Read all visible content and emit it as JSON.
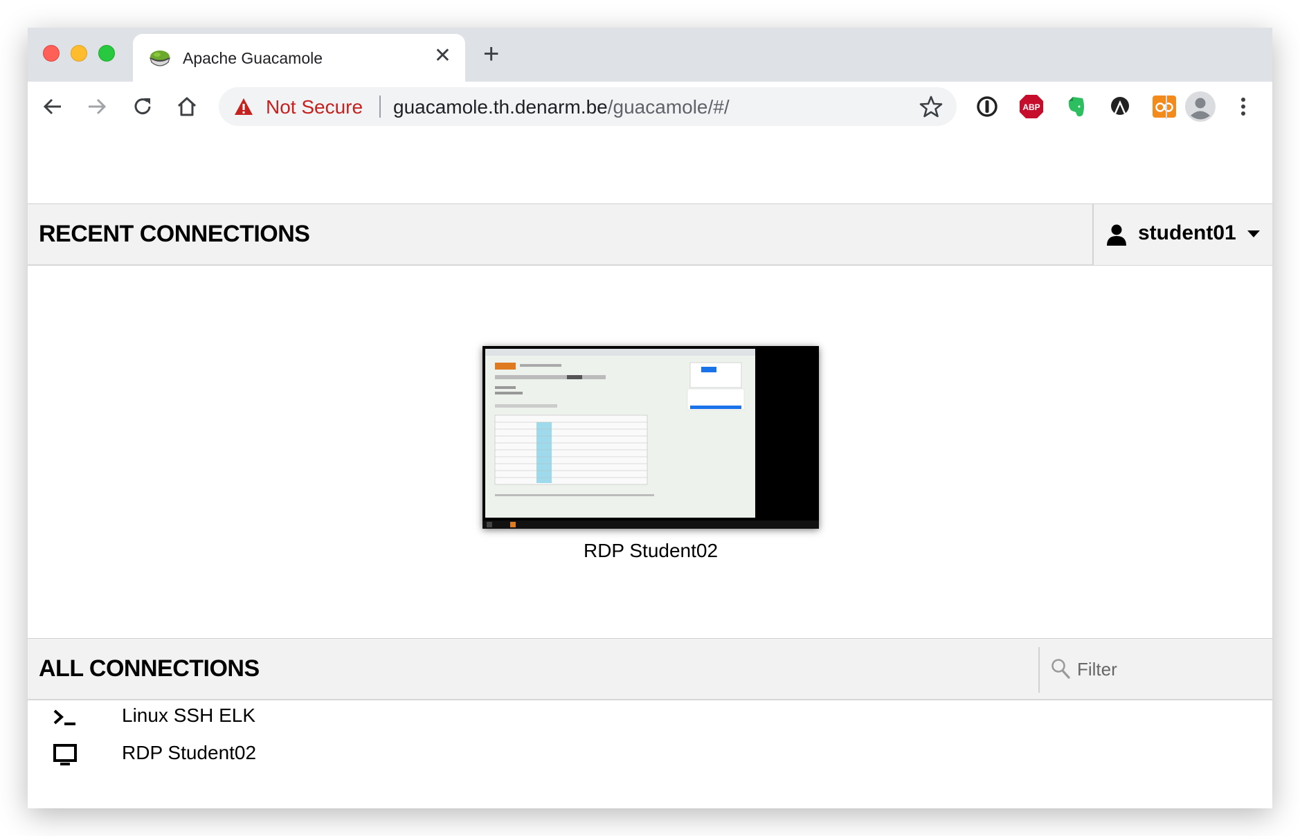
{
  "browser": {
    "tab": {
      "title": "Apache Guacamole",
      "favicon": "guacamole-bowl-icon"
    },
    "omnibox": {
      "security_label": "Not Secure",
      "url_host": "guacamole.th.denarm.be",
      "url_path": "/guacamole/#/"
    },
    "extensions": [
      "1password-icon",
      "adblock-plus-icon",
      "evernote-icon",
      "dark-reader-icon",
      "readerview-icon"
    ],
    "colors": {
      "tabstrip": "#dee1e6",
      "warning": "#c5221f"
    }
  },
  "guacamole": {
    "recent": {
      "title": "RECENT CONNECTIONS",
      "items": [
        {
          "name": "RDP Student02"
        }
      ]
    },
    "user_menu": {
      "username": "student01"
    },
    "all": {
      "title": "ALL CONNECTIONS",
      "filter_placeholder": "Filter",
      "connections": [
        {
          "name": "Linux SSH ELK",
          "icon": "terminal-icon"
        },
        {
          "name": "RDP Student02",
          "icon": "desktop-icon"
        }
      ]
    }
  }
}
